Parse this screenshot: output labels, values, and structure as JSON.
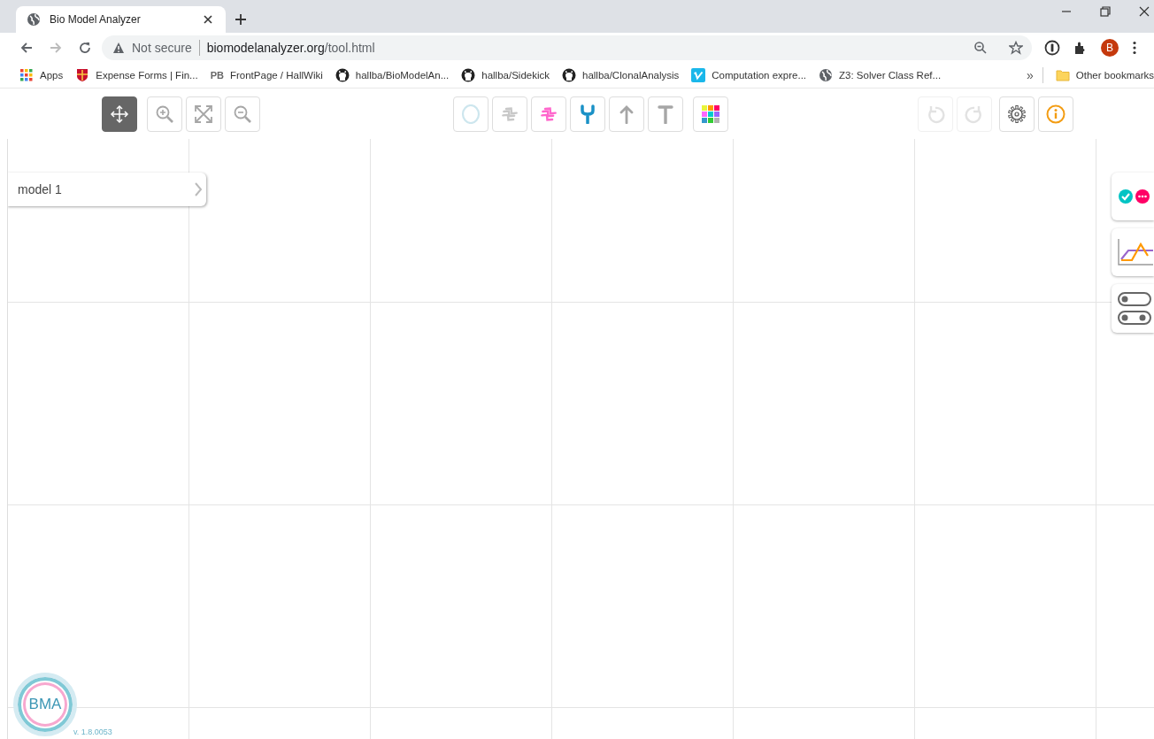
{
  "browser": {
    "tab": {
      "title": "Bio Model Analyzer",
      "selected": true
    },
    "address": {
      "warning": "Not secure",
      "host": "biomodelanalyzer.org",
      "path": "/tool.html"
    },
    "profile": "B",
    "bookmarks": [
      {
        "kind": "apps",
        "label": "Apps"
      },
      {
        "kind": "shield",
        "label": "Expense Forms | Fin..."
      },
      {
        "kind": "pb",
        "mark": "PB",
        "label": "FrontPage / HallWiki"
      },
      {
        "kind": "github",
        "label": "hallba/BioModelAn..."
      },
      {
        "kind": "github",
        "label": "hallba/Sidekick"
      },
      {
        "kind": "github",
        "label": "hallba/ClonalAnalysis"
      },
      {
        "kind": "vimeo",
        "label": "Computation expre..."
      },
      {
        "kind": "globe",
        "label": "Z3: Solver Class Ref..."
      }
    ],
    "overflow": "»",
    "other_bookmarks": "Other bookmarks"
  },
  "toolbar": {
    "navigation": [
      {
        "kind": "move",
        "selected": true
      },
      {
        "kind": "zoom-in",
        "selected": false
      },
      {
        "kind": "fit",
        "selected": false
      },
      {
        "kind": "zoom-out",
        "selected": false
      }
    ],
    "elements": [
      {
        "kind": "variable",
        "selected": false
      },
      {
        "kind": "container",
        "selected": false
      },
      {
        "kind": "membrane",
        "selected": false
      },
      {
        "kind": "receptor",
        "selected": false
      },
      {
        "kind": "activator",
        "selected": false
      },
      {
        "kind": "inhibitor",
        "selected": false
      }
    ],
    "palette": {
      "selected": false
    },
    "history": [
      {
        "kind": "undo",
        "disabled": true
      },
      {
        "kind": "redo",
        "disabled": true
      }
    ],
    "settings": [
      {
        "kind": "settings"
      },
      {
        "kind": "info"
      }
    ]
  },
  "model_panel": {
    "name": "model 1",
    "expanded": false
  },
  "side_tabs": [
    {
      "kind": "proof"
    },
    {
      "kind": "simulation"
    },
    {
      "kind": "further-testing"
    }
  ],
  "logo": {
    "text": "BMA",
    "version": "v. 1.8.0053"
  }
}
